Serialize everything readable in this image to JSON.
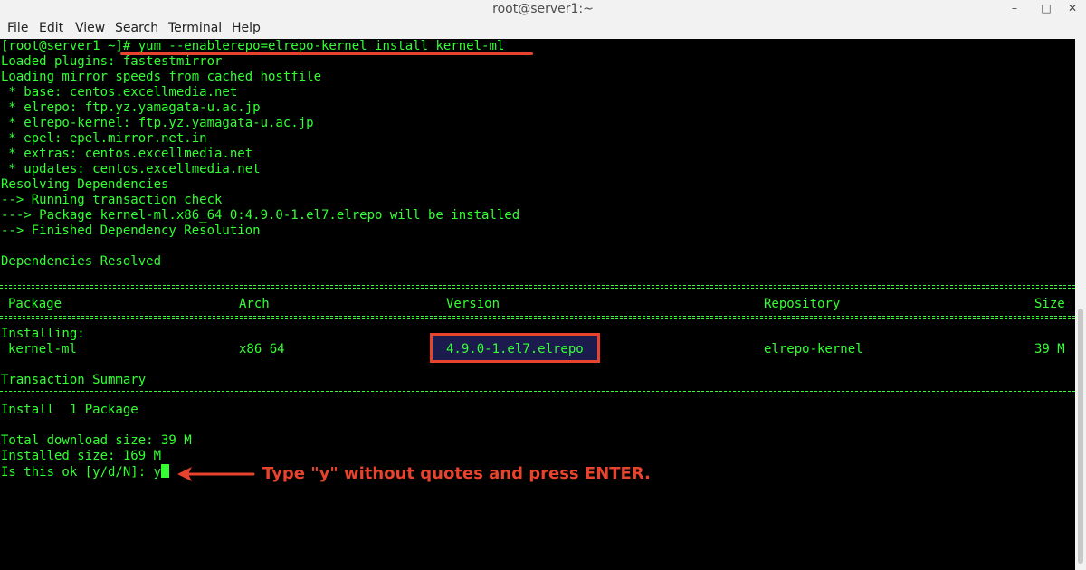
{
  "window": {
    "title": "root@server1:~",
    "minimize_glyph": "–",
    "maximize_glyph": "□",
    "close_glyph": "✕"
  },
  "menu": {
    "items": [
      "File",
      "Edit",
      "View",
      "Search",
      "Terminal",
      "Help"
    ]
  },
  "terminal": {
    "prompt": "[root@server1 ~]# ",
    "command": "yum --enablerepo=elrepo-kernel install kernel-ml",
    "output_lines": [
      "Loaded plugins: fastestmirror",
      "Loading mirror speeds from cached hostfile",
      " * base: centos.excellmedia.net",
      " * elrepo: ftp.yz.yamagata-u.ac.jp",
      " * elrepo-kernel: ftp.yz.yamagata-u.ac.jp",
      " * epel: epel.mirror.net.in",
      " * extras: centos.excellmedia.net",
      " * updates: centos.excellmedia.net",
      "Resolving Dependencies",
      "--> Running transaction check",
      "---> Package kernel-ml.x86_64 0:4.9.0-1.el7.elrepo will be installed",
      "--> Finished Dependency Resolution",
      "",
      "Dependencies Resolved"
    ],
    "table": {
      "headers": {
        "package": "Package",
        "arch": "Arch",
        "version": "Version",
        "repository": "Repository",
        "size": "Size"
      },
      "section_label": "Installing:",
      "row": {
        "package": "kernel-ml",
        "arch": "x86_64",
        "version": "4.9.0-1.el7.elrepo",
        "repository": "elrepo-kernel",
        "size": "39 M"
      }
    },
    "summary_title": "Transaction Summary",
    "install_line": "Install  1 Package",
    "total_download": "Total download size: 39 M",
    "installed_size": "Installed size: 169 M",
    "confirm_prompt": "Is this ok [y/d/N]: ",
    "typed_input": "y"
  },
  "annotation": {
    "text": "Type \"y\" without quotes and press ENTER."
  },
  "colors": {
    "terminal_text": "#33ff33",
    "terminal_bg": "#000000",
    "highlight": "#e8432c",
    "version_bg": "#1b1b4d"
  }
}
